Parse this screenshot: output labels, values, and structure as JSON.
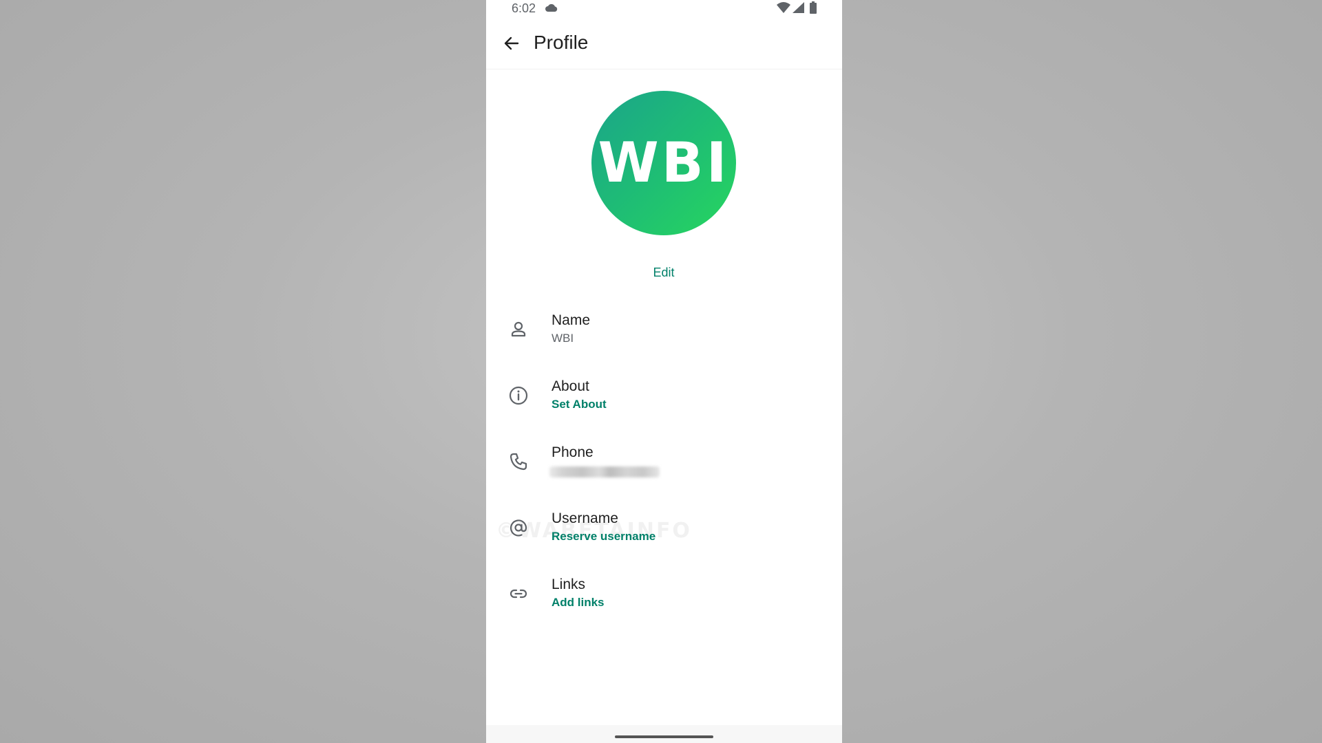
{
  "status_bar": {
    "time": "6:02",
    "icons": [
      "cloud-icon",
      "wifi-icon",
      "signal-icon",
      "battery-icon"
    ]
  },
  "app_bar": {
    "title": "Profile",
    "back_icon": "arrow-left-icon"
  },
  "avatar": {
    "text": "WBI",
    "gradient": [
      "#1aa48a",
      "#27d65e"
    ]
  },
  "edit_label": "Edit",
  "rows": [
    {
      "icon": "person-icon",
      "label": "Name",
      "value": "WBI"
    },
    {
      "icon": "info-icon",
      "label": "About",
      "value": "Set About"
    },
    {
      "icon": "phone-icon",
      "label": "Phone",
      "value": ""
    },
    {
      "icon": "at-sign-icon",
      "label": "Username",
      "value": "Reserve username"
    },
    {
      "icon": "link-icon",
      "label": "Links",
      "value": "Add links"
    }
  ],
  "watermark": "©WABETAINFO",
  "colors": {
    "accent": "#008069",
    "text_primary": "#1f1f1f",
    "text_secondary": "#5f6368",
    "background_outer": "#b4b4b4",
    "background_phone": "#ffffff"
  }
}
